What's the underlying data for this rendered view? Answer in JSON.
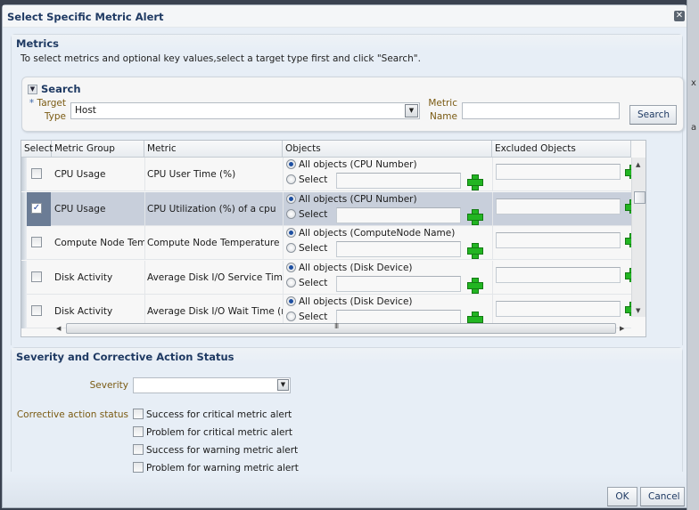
{
  "background": {
    "fragments": [
      "x",
      "a"
    ]
  },
  "dialog": {
    "title": "Select Specific Metric Alert",
    "close_icon": "close-icon"
  },
  "metrics": {
    "header": "Metrics",
    "instructions": "To select metrics and optional key values,select a target type first and click \"Search\".",
    "search": {
      "title": "Search",
      "required_marker": "*",
      "target_type_label_1": "Target",
      "target_type_label_2": "Type",
      "target_type_value": "Host",
      "metric_name_label_1": "Metric",
      "metric_name_label_2": "Name",
      "metric_name_value": "",
      "search_button": "Search"
    },
    "table": {
      "columns": [
        "Select",
        "Metric Group",
        "Metric",
        "Objects",
        "Excluded Objects"
      ],
      "rows": [
        {
          "selected": false,
          "group": "CPU Usage",
          "metric": "CPU User Time (%)",
          "all_objects": "All objects (CPU Number)",
          "select_label": "Select"
        },
        {
          "selected": true,
          "group": "CPU Usage",
          "metric": "CPU Utilization (%) of a cpu",
          "all_objects": "All objects (CPU Number)",
          "select_label": "Select"
        },
        {
          "selected": false,
          "group": "Compute Node Temperature",
          "metric": "Compute Node Temperature",
          "all_objects": "All objects (ComputeNode Name)",
          "select_label": "Select"
        },
        {
          "selected": false,
          "group": "Disk Activity",
          "metric": "Average Disk I/O Service Time (ms)",
          "all_objects": "All objects (Disk Device)",
          "select_label": "Select"
        },
        {
          "selected": false,
          "group": "Disk Activity",
          "metric": "Average Disk I/O Wait Time (ms)",
          "all_objects": "All objects (Disk Device)",
          "select_label": "Select"
        }
      ],
      "hscroll_grip": "III"
    }
  },
  "severity": {
    "header": "Severity and Corrective Action Status",
    "severity_label": "Severity",
    "severity_value": "",
    "corrective_label": "Corrective action status",
    "options": [
      {
        "label": "Success for critical metric alert",
        "checked": false
      },
      {
        "label": "Problem for critical metric alert",
        "checked": false
      },
      {
        "label": "Success for warning metric alert",
        "checked": false
      },
      {
        "label": "Problem for warning metric alert",
        "checked": false
      }
    ]
  },
  "footer": {
    "ok": "OK",
    "cancel": "Cancel"
  }
}
